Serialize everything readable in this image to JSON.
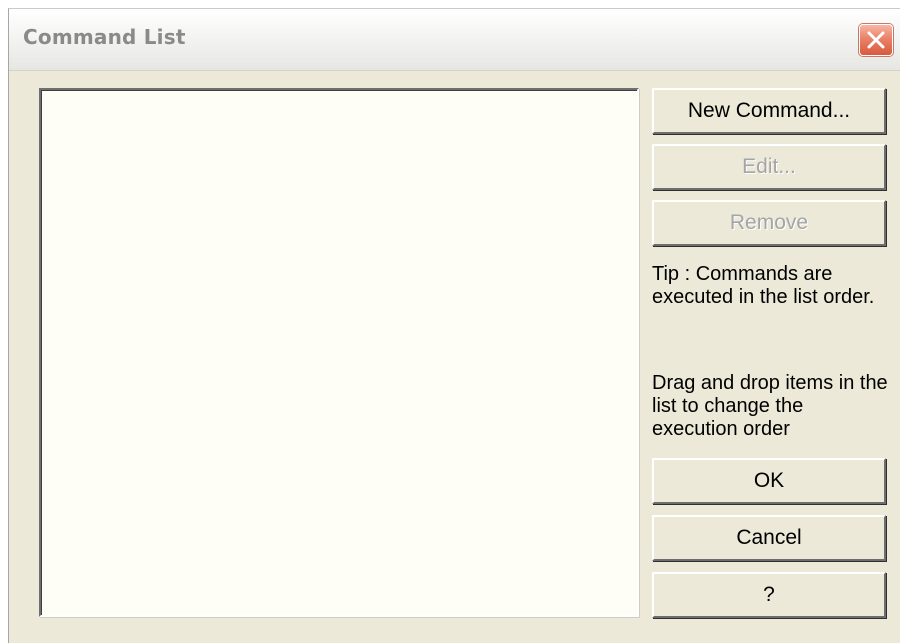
{
  "window": {
    "title": "Command List",
    "close_icon": "close-icon"
  },
  "buttons": {
    "new_command": "New Command...",
    "edit": "Edit...",
    "remove": "Remove",
    "ok": "OK",
    "cancel": "Cancel",
    "help": "?"
  },
  "tips": {
    "order": "Tip : Commands are executed in the list order.",
    "drag": "Drag and drop items in the list to change the execution order"
  },
  "command_list": {
    "items": []
  },
  "colors": {
    "dialog_bg": "#ece9d8",
    "list_bg": "#fefef6",
    "close_button": "#e98268",
    "disabled_text": "#a5a5a5"
  }
}
